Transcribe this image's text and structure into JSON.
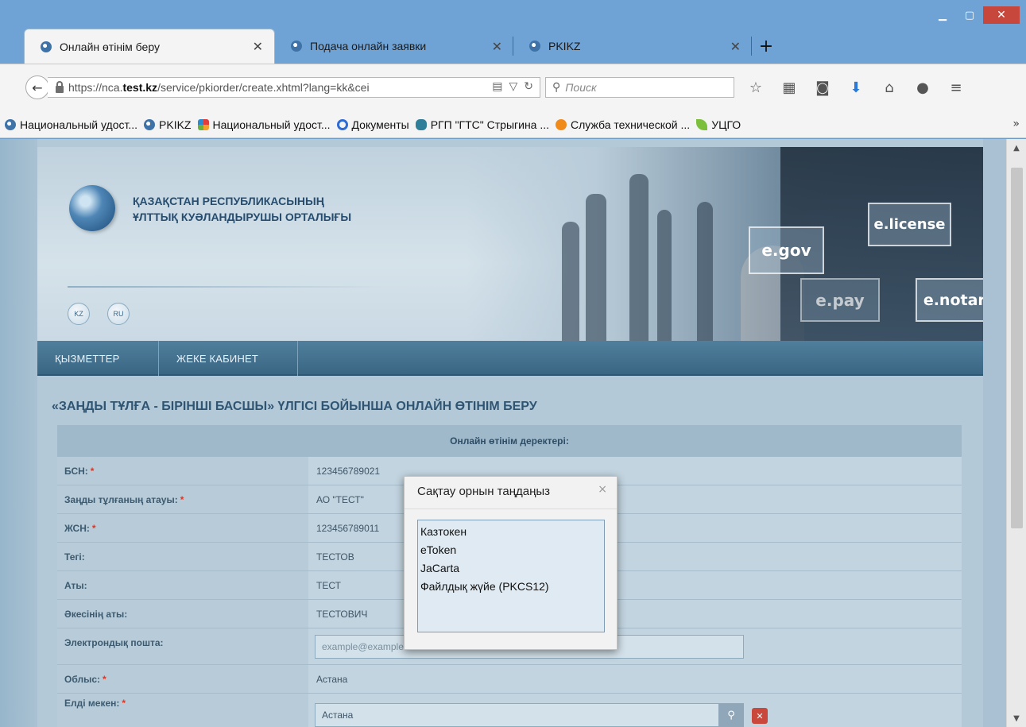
{
  "browser": {
    "tabs": [
      {
        "label": "Онлайн өтінім беру"
      },
      {
        "label": "Подача онлайн заявки"
      },
      {
        "label": "PKIKZ"
      }
    ],
    "url_prefix": "https://nca.",
    "url_host": "test.kz",
    "url_path": "/service/pkiorder/create.xhtml?lang=kk&cei",
    "search_placeholder": "Поиск",
    "bookmarks": [
      {
        "label": "Национальный удост...",
        "icon": "globe-icon"
      },
      {
        "label": "PKIKZ",
        "icon": "globe-icon"
      },
      {
        "label": "Национальный удост...",
        "icon": "joomla-icon"
      },
      {
        "label": "Документы",
        "icon": "ring-icon"
      },
      {
        "label": "РГП \"ГТС\" Стрыгина ...",
        "icon": "shield-icon"
      },
      {
        "label": "Служба технической ...",
        "icon": "n-icon"
      },
      {
        "label": "УЦГО",
        "icon": "leaf-icon"
      }
    ]
  },
  "site": {
    "logo_line1": "ҚАЗАҚСТАН РЕСПУБЛИКАСЫНЫҢ",
    "logo_line2": "ҰЛТТЫҚ КУӘЛАНДЫРУШЫ ОРТАЛЫҒЫ",
    "lang_kz": "KZ",
    "lang_ru": "RU",
    "banner": {
      "egov": "e.gov",
      "license": "e.license",
      "pay": "e.pay",
      "notary": "e.notary"
    },
    "menu": [
      {
        "label": "ҚЫЗМЕТТЕР"
      },
      {
        "label": "ЖЕКЕ КАБИНЕТ"
      }
    ]
  },
  "form": {
    "heading": "«ЗАҢДЫ ТҰЛҒА - БІРІНШІ БАСШЫ» ҮЛГІСІ БОЙЫНША ОНЛАЙН ӨТІНІМ БЕРУ",
    "section_title": "Онлайн өтінім деректері:",
    "fields": [
      {
        "label": "БСН:",
        "required": "*",
        "value": "123456789021"
      },
      {
        "label": "Заңды тұлғаның атауы:",
        "required": "*",
        "value": "АО \"ТЕСТ\""
      },
      {
        "label": "ЖСН:",
        "required": "*",
        "value": "123456789011"
      },
      {
        "label": "Тегі:",
        "required": "",
        "value": "ТЕСТОВ"
      },
      {
        "label": "Аты:",
        "required": "",
        "value": "ТЕСТ"
      },
      {
        "label": "Әкесінің аты:",
        "required": "",
        "value": "ТЕСТОВИЧ"
      }
    ],
    "email_label": "Электрондық пошта:",
    "email_placeholder": "example@example.kz",
    "region_label": "Облыс:",
    "region_required": "*",
    "region_value": "Астана",
    "city_label": "Елді мекен:",
    "city_required": "*",
    "city_value": "Астана"
  },
  "dialog": {
    "title": "Сақтау орнын таңдаңыз",
    "close": "×",
    "options": [
      "Казтокен",
      "eToken",
      "JaCarta",
      "Файлдық жүйе (PKCS12)"
    ]
  }
}
